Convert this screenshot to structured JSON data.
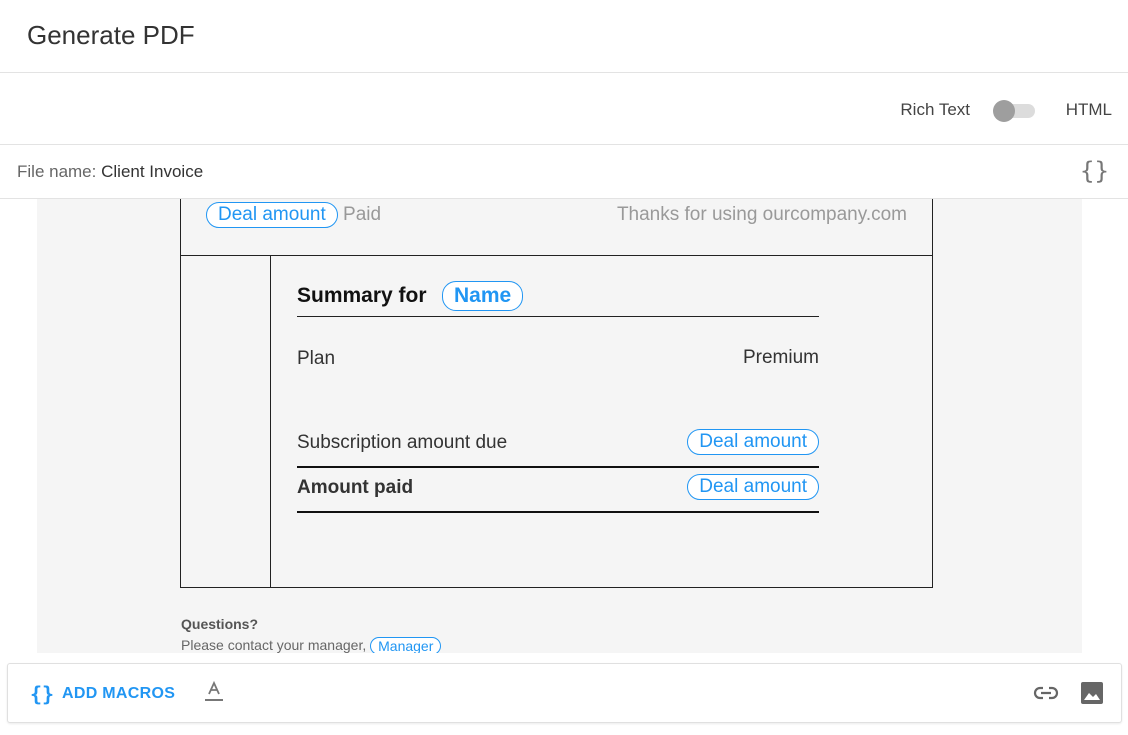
{
  "header": {
    "title": "Generate PDF"
  },
  "mode": {
    "rich_text_label": "Rich Text",
    "html_label": "HTML",
    "html_enabled": false
  },
  "file": {
    "label": "File name:",
    "value": "Client Invoice"
  },
  "document": {
    "top": {
      "amount_macro": "Deal amount",
      "paid_text": "Paid",
      "thanks": "Thanks for using ourcompany.com"
    },
    "summary": {
      "title": "Summary for",
      "name_macro": "Name",
      "rows": [
        {
          "label": "Plan",
          "value": "Premium"
        },
        {
          "label": "Subscription amount due",
          "macro": "Deal amount"
        },
        {
          "label": "Amount paid",
          "macro": "Deal amount"
        }
      ]
    },
    "questions": {
      "heading": "Questions?",
      "text": "Please contact your manager,",
      "manager_macro": "Manager"
    }
  },
  "toolbar": {
    "add_macros_label": "ADD MACROS",
    "icons": [
      "braces-icon",
      "text-format-icon",
      "link-icon",
      "image-icon"
    ]
  },
  "colors": {
    "accent": "#2196f3",
    "editor_bg": "#f5f5f5"
  }
}
